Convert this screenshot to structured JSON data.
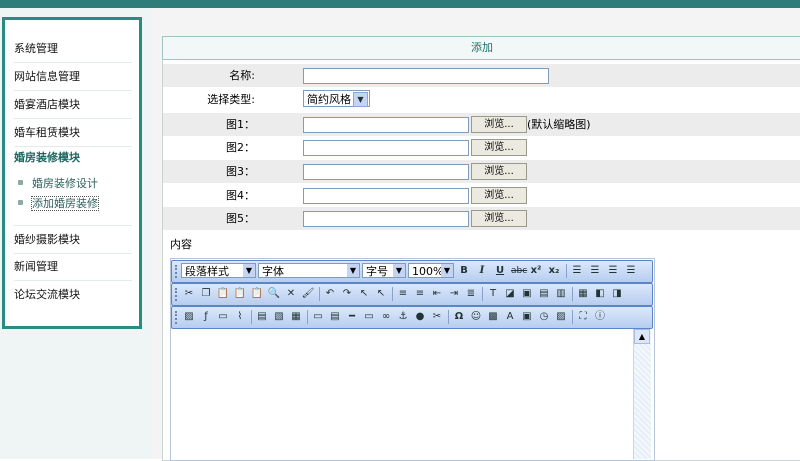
{
  "sidebar": {
    "items": [
      {
        "label": "系统管理"
      },
      {
        "label": "网站信息管理"
      },
      {
        "label": "婚宴酒店模块"
      },
      {
        "label": "婚车租赁模块"
      },
      {
        "label": "婚房装修模块"
      },
      {
        "label": "婚纱摄影模块"
      },
      {
        "label": "新闻管理"
      },
      {
        "label": "论坛交流模块"
      }
    ],
    "subitems": [
      {
        "label": "婚房装修设计"
      },
      {
        "label": "添加婚房装修"
      }
    ]
  },
  "form": {
    "title": "添加",
    "name_label": "名称:",
    "name_value": "",
    "type_label": "选择类型:",
    "type_value": "简约风格",
    "images": [
      {
        "label": "图1：",
        "value": ""
      },
      {
        "label": "图2：",
        "value": ""
      },
      {
        "label": "图3：",
        "value": ""
      },
      {
        "label": "图4：",
        "value": ""
      },
      {
        "label": "图5：",
        "value": ""
      }
    ],
    "browse_label": "浏览...",
    "default_note": "(默认缩略图)",
    "content_label": "内容"
  },
  "editor": {
    "paragraph_style": "段落样式",
    "font": "字体",
    "font_size": "字号",
    "zoom": "100%"
  },
  "colors": {
    "accent": "#2a8a84",
    "toolbar": "#b7cdf0"
  }
}
